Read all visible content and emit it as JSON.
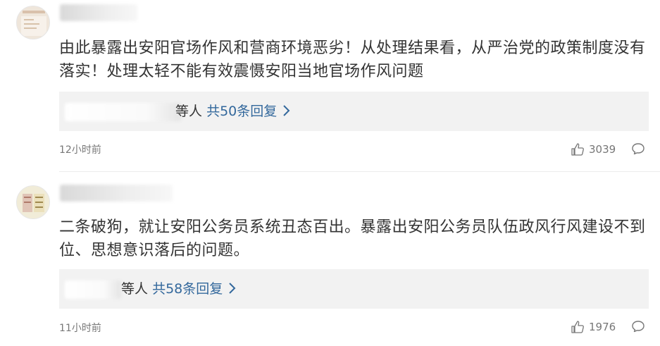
{
  "comments": [
    {
      "text": "由此暴露出安阳官场作风和营商环境恶劣！从处理结果看，从严治党的政策制度没有落实！处理太轻不能有效震慑安阳当地官场作风问题",
      "replies_who": "等人",
      "replies_count": "共50条回复",
      "time": "12小时前",
      "likes": "3039",
      "reply_icon": "comment-icon",
      "like_icon": "thumbs-up-icon"
    },
    {
      "text": "二条破狗，就让安阳公务员系统丑态百出。暴露出安阳公务员队伍政风行风建设不到位、思想意识落后的问题。",
      "replies_who": "等人",
      "replies_count": "共58条回复",
      "time": "11小时前",
      "likes": "1976",
      "reply_icon": "comment-icon",
      "like_icon": "thumbs-up-icon"
    }
  ],
  "colors": {
    "link": "#33689c",
    "meta": "#777777",
    "text": "#333333",
    "reply_bg": "#f2f2f2"
  }
}
